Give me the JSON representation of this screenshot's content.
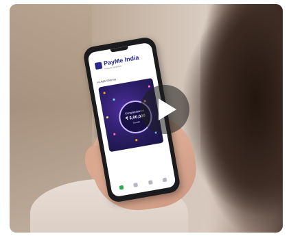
{
  "video": {
    "play_icon": "play-icon"
  },
  "app": {
    "brand_name": "PayMe India",
    "tagline": "Finance Simplified",
    "greeting": "Hi Aditi Sharma",
    "banner": {
      "title": "Congratulations",
      "amount": "₹ 2,00,000",
      "subtitle": "Transfer"
    },
    "nav_icons": [
      "home-icon",
      "card-icon",
      "chart-icon",
      "profile-icon"
    ]
  },
  "colors": {
    "brand": "#2b2a8c",
    "banner_bg": "#2a1d63",
    "nav_active": "#2fa84f"
  }
}
